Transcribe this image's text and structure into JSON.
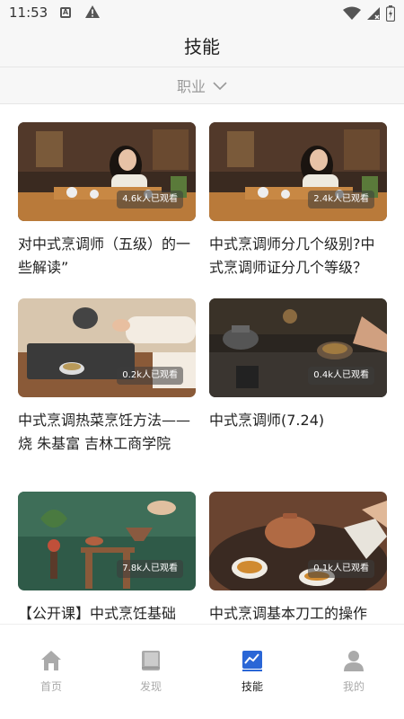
{
  "status": {
    "time": "11:53"
  },
  "header": {
    "title": "技能"
  },
  "filter": {
    "label": "职业"
  },
  "cards": [
    {
      "title": "对中式烹调师（五级）的一些解读”",
      "views": "4.6k人已观看"
    },
    {
      "title": "中式烹调师分几个级别?中式烹调师证分几个等级？",
      "views": "2.4k人已观看"
    },
    {
      "title": "中式烹调热菜烹饪方法——烧 朱基富 吉林工商学院",
      "views": "0.2k人已观看"
    },
    {
      "title": "中式烹调师(7.24)",
      "views": "0.4k人已观看"
    },
    {
      "title": "【公开课】中式烹饪基础",
      "views": "7.8k人已观看"
    },
    {
      "title": "中式烹调基本刀工的操作",
      "views": "0.1k人已观看"
    }
  ],
  "tabbar": {
    "items": [
      {
        "label": "首页",
        "icon": "home-icon"
      },
      {
        "label": "发现",
        "icon": "book-icon"
      },
      {
        "label": "技能",
        "icon": "chart-icon"
      },
      {
        "label": "我的",
        "icon": "user-icon"
      }
    ],
    "active_index": 2
  },
  "colors": {
    "accent": "#2a66d6",
    "inactive": "#aaaaaa"
  }
}
